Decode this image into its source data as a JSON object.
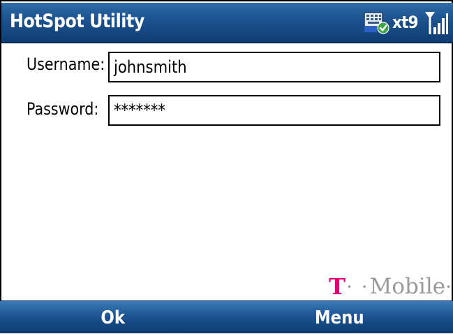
{
  "title_bar": {
    "title": "HotSpot Utility",
    "input_mode": "xt9",
    "colors": {
      "bar_top": "#2f6ea8",
      "bar_bottom": "#0f3d73"
    }
  },
  "status_icons": {
    "keyboard_icon": "keyboard-with-check-icon",
    "signal_icon": "signal-strength-icon"
  },
  "form": {
    "username": {
      "label": "Username:",
      "value": "johnsmith"
    },
    "password": {
      "label": "Password:",
      "value": "*******"
    }
  },
  "brand": {
    "t": "T",
    "dots": "· ·",
    "name": "Mobile",
    "end_dot": "·",
    "colors": {
      "t_magenta": "#e20074",
      "gray": "#9a9a9a"
    }
  },
  "softkeys": {
    "left": "Ok",
    "right": "Menu"
  }
}
